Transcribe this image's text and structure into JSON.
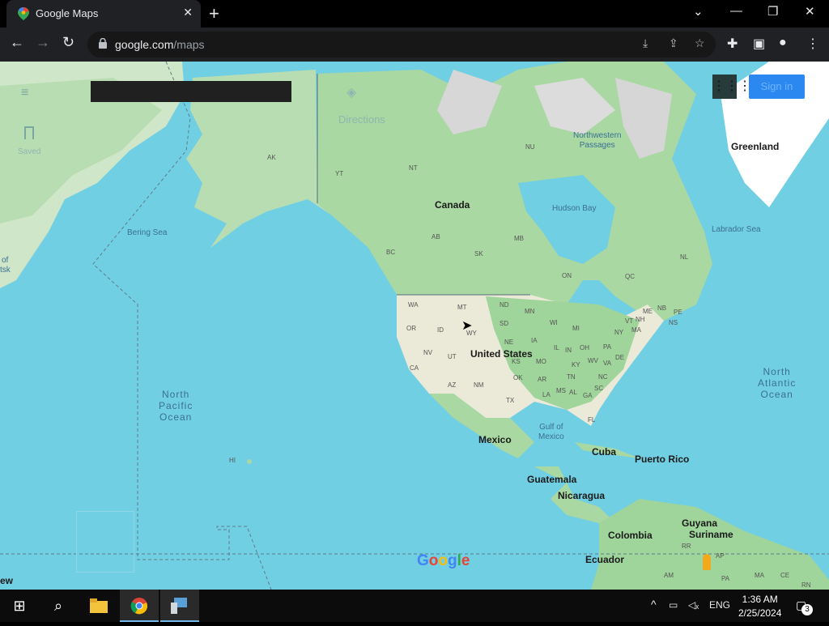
{
  "browser": {
    "tab_title": "Google Maps",
    "tab_close": "✕",
    "new_tab": "+",
    "window_controls": [
      "⌄",
      "—",
      "❐",
      "✕"
    ],
    "nav": {
      "back": "←",
      "forward": "→",
      "reload": "↻"
    },
    "url_domain": "google.com",
    "url_path": "/maps",
    "omnibox_actions": [
      "⤓",
      "⇪",
      "☆"
    ],
    "extensions": [
      "✚",
      "▣",
      "●",
      "⋮"
    ]
  },
  "maps_ui": {
    "menu_icon": "≡",
    "saved_label": "Saved",
    "directions_icon": "◈",
    "directions_label": "Directions",
    "apps_icon": "⋮⋮⋮",
    "sign_in_label": "Sign in"
  },
  "map_labels": {
    "countries": {
      "canada": "Canada",
      "united_states": "United States",
      "mexico": "Mexico",
      "cuba": "Cuba",
      "puerto_rico": "Puerto Rico",
      "guatemala": "Guatemala",
      "nicaragua": "Nicaragua",
      "colombia": "Colombia",
      "ecuador": "Ecuador",
      "guyana": "Guyana",
      "suriname": "Suriname",
      "greenland": "Greenland"
    },
    "water": {
      "bering_sea": "Bering Sea",
      "hudson_bay": "Hudson Bay",
      "labrador_sea": "Labrador Sea",
      "gulf_of_mexico": "Gulf of\nMexico",
      "northwest_passages": "Northwestern\nPassages"
    },
    "oceans": {
      "north_pacific": "North\nPacific\nOcean",
      "north_atlantic": "North\nAtlantic\nOcean"
    },
    "regions": {
      "ak": "AK",
      "yt": "YT",
      "nt": "NT",
      "nu": "NU",
      "bc": "BC",
      "ab": "AB",
      "sk": "SK",
      "mb": "MB",
      "on": "ON",
      "qc": "QC",
      "nl": "NL",
      "nb": "NB",
      "pe": "PE",
      "ns": "NS",
      "wa": "WA",
      "or": "OR",
      "ca": "CA",
      "nv": "NV",
      "id": "ID",
      "mt": "MT",
      "wy": "WY",
      "ut": "UT",
      "az": "AZ",
      "nm": "NM",
      "nd": "ND",
      "sd": "SD",
      "ne": "NE",
      "ks": "KS",
      "ok": "OK",
      "tx": "TX",
      "mn": "MN",
      "ia": "IA",
      "mo": "MO",
      "ar": "AR",
      "la": "LA",
      "wi": "WI",
      "il": "IL",
      "mi": "MI",
      "in": "IN",
      "oh": "OH",
      "ky": "KY",
      "tn": "TN",
      "ms": "MS",
      "al": "AL",
      "ga": "GA",
      "fl": "FL",
      "sc": "SC",
      "nc": "NC",
      "va": "VA",
      "wv": "WV",
      "pa": "PA",
      "ny": "NY",
      "de": "DE",
      "vt": "VT",
      "nh": "NH",
      "me": "ME",
      "ma": "MA",
      "hi": "HI",
      "rr": "RR",
      "pa_br": "PA",
      "am": "AM",
      "ap": "AP",
      "ma_br": "MA",
      "ce": "CE",
      "rn": "RN"
    },
    "partial": {
      "of": "of",
      "tsk": "tsk",
      "ew": "ew"
    }
  },
  "google_logo": [
    "G",
    "o",
    "o",
    "g",
    "l",
    "e"
  ],
  "logo_colors": [
    "#4285f4",
    "#ea4335",
    "#fbbc05",
    "#4285f4",
    "#34a853",
    "#ea4335"
  ],
  "taskbar": {
    "start_icon": "⊞",
    "search_icon": "⌕",
    "tray_chevron": "^",
    "language": "ENG",
    "time": "1:36 AM",
    "date": "2/25/2024",
    "notification_count": "3"
  }
}
